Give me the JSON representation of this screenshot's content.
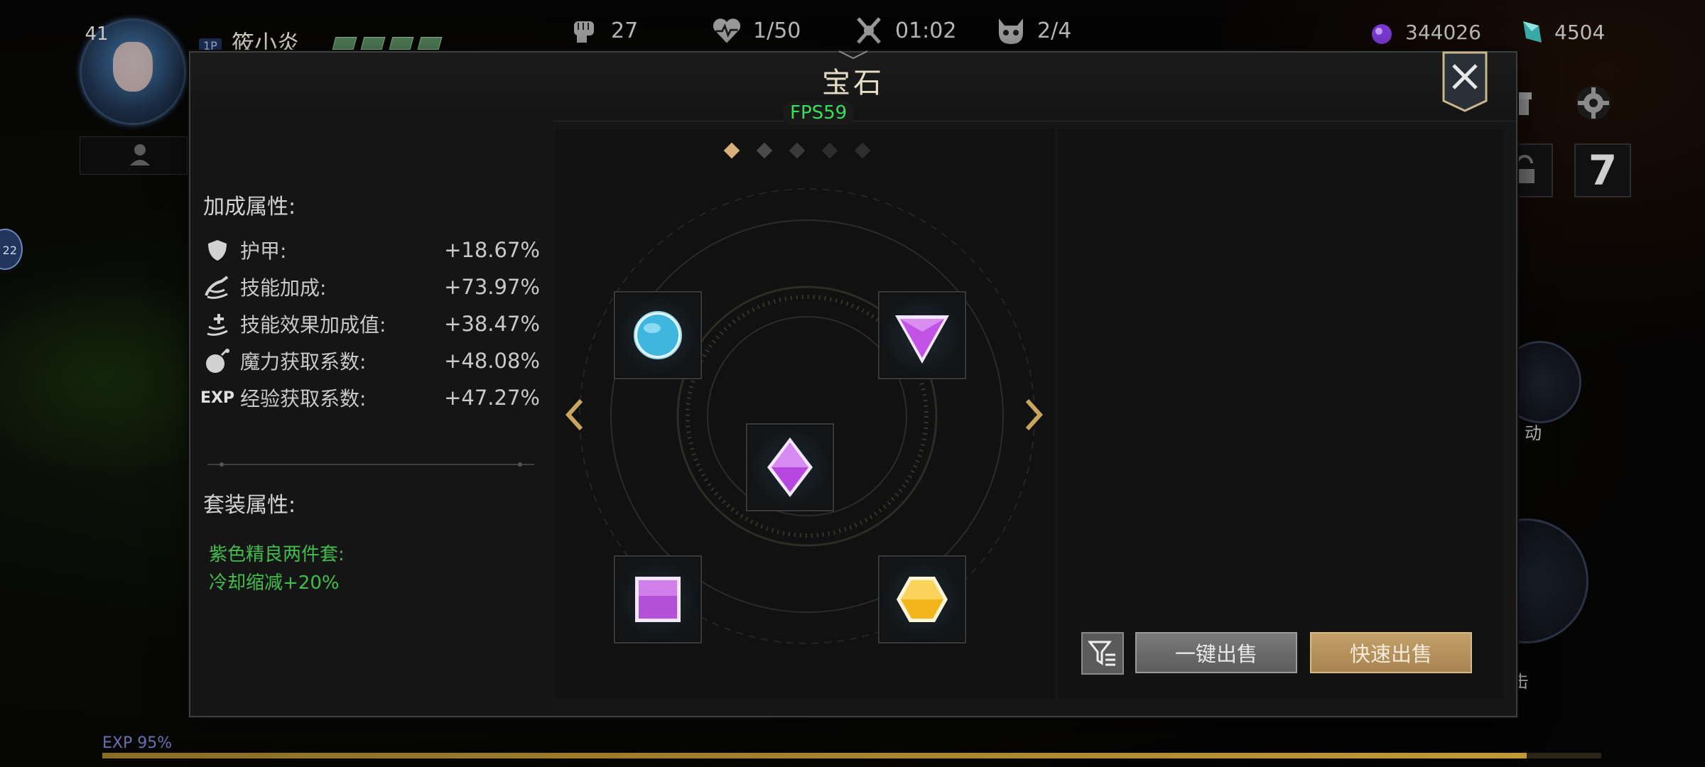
{
  "hud": {
    "level": "41",
    "player_tag": "1P",
    "player_name": "筱小炎",
    "kills": "27",
    "lives": "1/50",
    "timer": "01:02",
    "wave": "2/4",
    "currency_purple": "344026",
    "currency_crystal": "4504",
    "side_badge": "22",
    "right_square_number": "7",
    "right_label_1": "动",
    "right_label_2": "击",
    "exp_label": "EXP 95%",
    "exp_percent": 95
  },
  "panel": {
    "title": "宝石",
    "fps": "FPS59"
  },
  "bonus": {
    "title": "加成属性:",
    "rows": [
      {
        "icon": "shield-icon",
        "name": "护甲:",
        "value": "+18.67%"
      },
      {
        "icon": "skill-power-icon",
        "name": "技能加成:",
        "value": "+73.97%"
      },
      {
        "icon": "skill-effect-icon",
        "name": "技能效果加成值:",
        "value": "+38.47%"
      },
      {
        "icon": "mana-icon",
        "name": "魔力获取系数:",
        "value": "+48.08%"
      },
      {
        "icon": "exp-icon",
        "name": "经验获取系数:",
        "value": "+47.27%"
      }
    ],
    "exp_icon_text": "EXP"
  },
  "set_bonus": {
    "title": "套装属性:",
    "line1": "紫色精良两件套:",
    "line2": "冷却缩减+20%"
  },
  "gem_slots": [
    {
      "position": "top-left",
      "gem": "blue-circle"
    },
    {
      "position": "top-right",
      "gem": "purple-triangle"
    },
    {
      "position": "center",
      "gem": "purple-diamond"
    },
    {
      "position": "bottom-left",
      "gem": "purple-square"
    },
    {
      "position": "bottom-right",
      "gem": "yellow-hexagon"
    }
  ],
  "pagination": {
    "total": 5,
    "current": 1
  },
  "actions": {
    "sell_all": "一键出售",
    "quick_sell": "快速出售"
  },
  "colors": {
    "accent_gold": "#d6b27a",
    "set_green": "#3fbf4a",
    "fps_green": "#35e05a"
  }
}
